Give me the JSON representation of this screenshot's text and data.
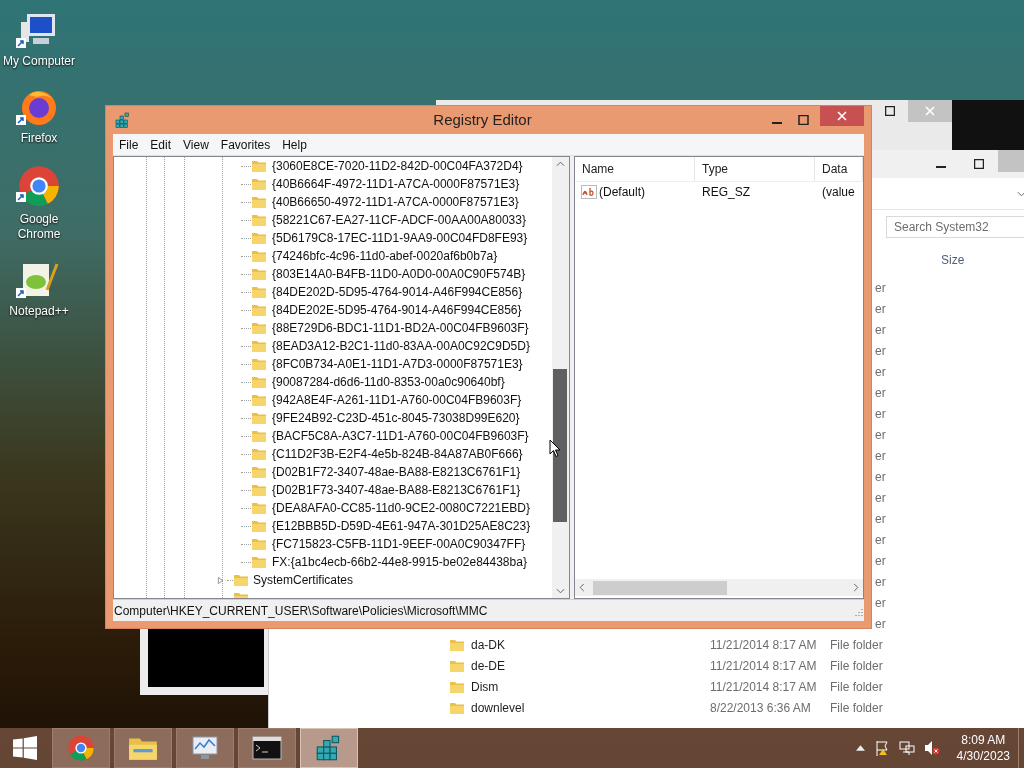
{
  "desktop_icons": [
    {
      "label": "My Computer",
      "kind": "computer"
    },
    {
      "label": "Firefox",
      "kind": "firefox"
    },
    {
      "label": "Google Chrome",
      "kind": "chrome"
    },
    {
      "label": "Notepad++",
      "kind": "notepad"
    }
  ],
  "explorer": {
    "search": {
      "placeholder": "Search System32"
    },
    "columns": [
      "Size"
    ],
    "rows": [
      {
        "type": "er"
      },
      {
        "type": "er"
      },
      {
        "type": "er"
      },
      {
        "type": "er"
      },
      {
        "type": "er"
      },
      {
        "type": "er"
      },
      {
        "type": "er"
      },
      {
        "type": "er"
      },
      {
        "type": "er"
      },
      {
        "type": "er"
      },
      {
        "type": "er"
      },
      {
        "type": "er"
      },
      {
        "type": "er"
      },
      {
        "type": "er"
      },
      {
        "type": "er"
      },
      {
        "type": "er"
      },
      {
        "type": "er"
      },
      {
        "name": "da-DK",
        "date": "11/21/2014 8:17 AM",
        "type": "File folder"
      },
      {
        "name": "de-DE",
        "date": "11/21/2014 8:17 AM",
        "type": "File folder"
      },
      {
        "name": "Dism",
        "date": "11/21/2014 8:17 AM",
        "type": "File folder"
      },
      {
        "name": "downlevel",
        "date": "8/22/2013 6:36 AM",
        "type": "File folder"
      }
    ]
  },
  "registry_editor": {
    "title": "Registry Editor",
    "menu": [
      "File",
      "Edit",
      "View",
      "Favorites",
      "Help"
    ],
    "tree": {
      "items": [
        {
          "expanded": true,
          "children": [
            {
              "label": "{3060E8CE-7020-11D2-842D-00C04FA372D4}"
            },
            {
              "label": "{40B6664F-4972-11D1-A7CA-0000F87571E3}"
            },
            {
              "label": "{40B66650-4972-11D1-A7CA-0000F87571E3}"
            },
            {
              "label": "{58221C67-EA27-11CF-ADCF-00AA00A80033}"
            },
            {
              "label": "{5D6179C8-17EC-11D1-9AA9-00C04FD8FE93}"
            },
            {
              "label": "{74246bfc-4c96-11d0-abef-0020af6b0b7a}"
            },
            {
              "label": "{803E14A0-B4FB-11D0-A0D0-00A0C90F574B}"
            },
            {
              "label": "{84DE202D-5D95-4764-9014-A46F994CE856}"
            },
            {
              "label": "{84DE202E-5D95-4764-9014-A46F994CE856}"
            },
            {
              "label": "{88E729D6-BDC1-11D1-BD2A-00C04FB9603F}"
            },
            {
              "label": "{8EAD3A12-B2C1-11d0-83AA-00A0C92C9D5D}"
            },
            {
              "label": "{8FC0B734-A0E1-11D1-A7D3-0000F87571E3}"
            },
            {
              "label": "{90087284-d6d6-11d0-8353-00a0c90640bf}"
            },
            {
              "label": "{942A8E4F-A261-11D1-A760-00C04FB9603F}"
            },
            {
              "label": "{9FE24B92-C23D-451c-8045-73038D99E620}"
            },
            {
              "label": "{BACF5C8A-A3C7-11D1-A760-00C04FB9603F}"
            },
            {
              "label": "{C11D2F3B-E2F4-4e5b-824B-84A87AB0F666}"
            },
            {
              "label": "{D02B1F72-3407-48ae-BA88-E8213C6761F1}"
            },
            {
              "label": "{D02B1F73-3407-48ae-BA88-E8213C6761F1}"
            },
            {
              "label": "{DEA8AFA0-CC85-11d0-9CE2-0080C7221EBD}"
            },
            {
              "label": "{E12BBB5D-D59D-4E61-947A-301D25AE8C23}"
            },
            {
              "label": "{FC715823-C5FB-11D1-9EEF-00A0C90347FF}"
            },
            {
              "label": "FX:{a1bc4ecb-66b2-44e8-9915-be02e84438ba}"
            }
          ]
        },
        {
          "label": "SystemCertificates",
          "expanded": false
        }
      ]
    },
    "values": {
      "columns": [
        "Name",
        "Type",
        "Data"
      ],
      "rows": [
        {
          "name": "(Default)",
          "type": "REG_SZ",
          "data": "(value"
        }
      ]
    },
    "status_bar": "Computer\\HKEY_CURRENT_USER\\Software\\Policies\\Microsoft\\MMC"
  },
  "taskbar": {
    "apps": [
      {
        "kind": "chrome",
        "selected": false
      },
      {
        "kind": "explorer",
        "selected": false
      },
      {
        "kind": "monitor",
        "selected": false
      },
      {
        "kind": "cmd",
        "selected": false
      },
      {
        "kind": "regedit",
        "selected": true
      }
    ],
    "clock": {
      "time": "8:09 AM",
      "date": "4/30/2023"
    }
  }
}
